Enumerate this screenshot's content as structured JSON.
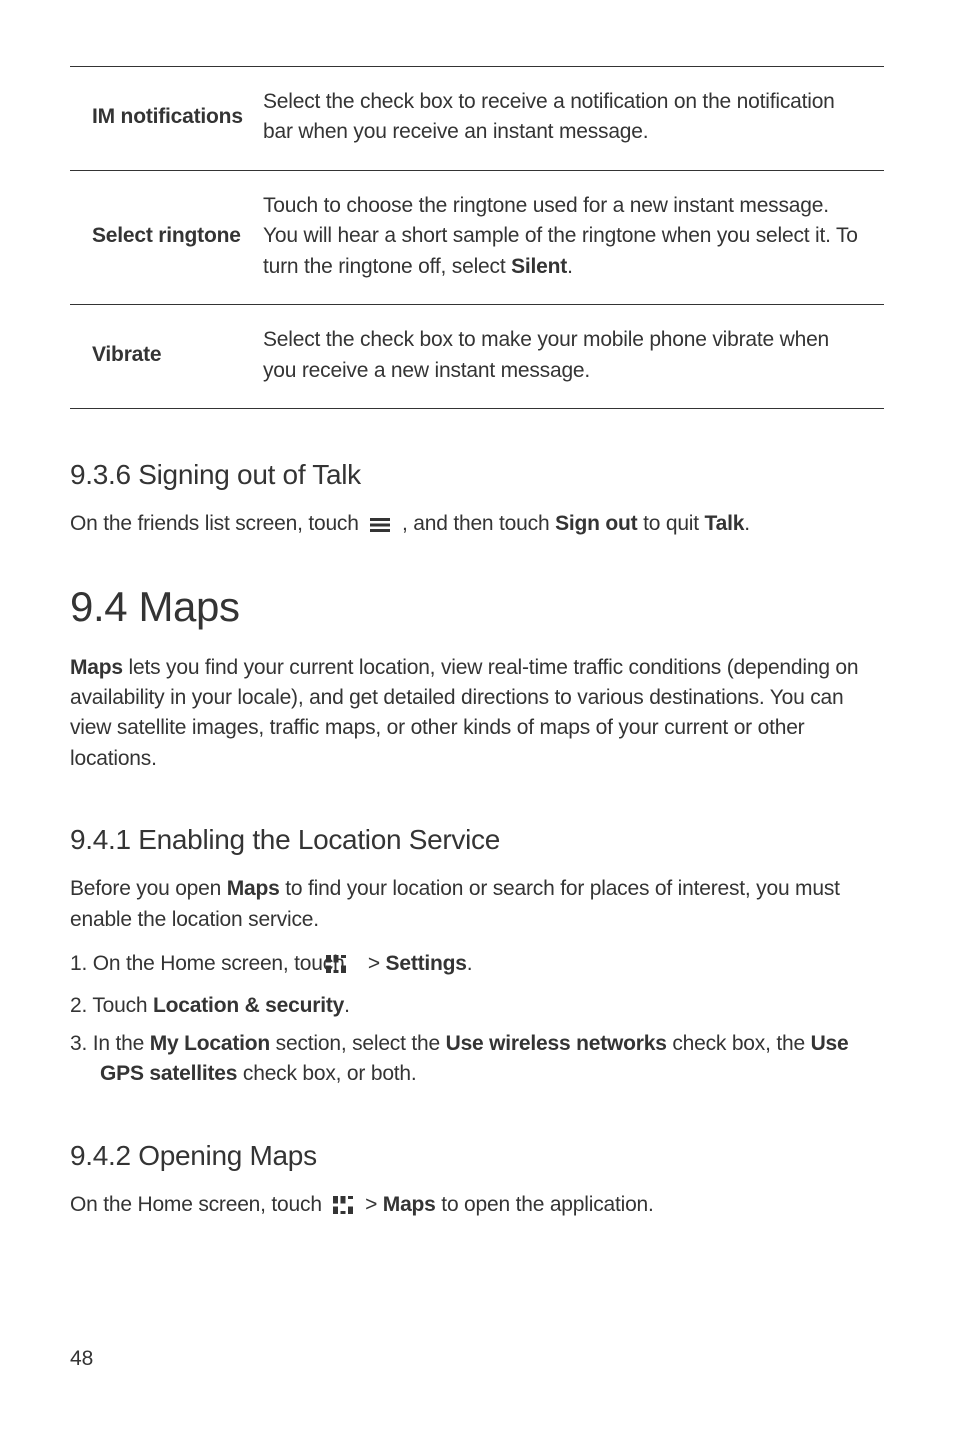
{
  "table": {
    "rows": [
      {
        "label": "IM notifications",
        "desc_plain": "Select the check box to receive a notification on the notification bar when you receive an instant message."
      },
      {
        "label": "Select ringtone",
        "desc_pre": "Touch to choose the ringtone used for a new instant message. You will hear a short sample of the ringtone when you select it. To turn the ringtone off, select ",
        "desc_bold": "Silent",
        "desc_post": "."
      },
      {
        "label": "Vibrate",
        "desc_plain": "Select the check box to make your mobile phone vibrate when you receive a new instant message."
      }
    ]
  },
  "sec936": {
    "heading": "9.3.6  Signing out of Talk",
    "p_pre": "On the friends list screen, touch ",
    "p_mid": " , and then touch ",
    "p_b1": "Sign out",
    "p_mid2": " to quit ",
    "p_b2": "Talk",
    "p_post": "."
  },
  "sec94": {
    "heading": "9.4  Maps",
    "intro_b": "Maps",
    "intro_rest": " lets you find your current location, view real-time traffic conditions (depending on availability in your locale), and get detailed directions to various destinations. You can view satellite images, traffic maps, or other kinds of maps of your current or other locations."
  },
  "sec941": {
    "heading": "9.4.1  Enabling the Location Service",
    "p_pre": "Before you open ",
    "p_b": "Maps",
    "p_post": " to find your location or search for places of interest, you must enable the location service.",
    "step1_pre": "1. On the Home screen, touch ",
    "step1_gt": "  > ",
    "step1_b": "Settings",
    "step1_post": ".",
    "step2_pre": "2. Touch ",
    "step2_b": "Location & security",
    "step2_post": ".",
    "step3_pre": "3. In the ",
    "step3_b1": "My Location",
    "step3_mid1": " section, select the ",
    "step3_b2": "Use wireless networks",
    "step3_mid2": " check box, the ",
    "step3_b3": "Use GPS satellites",
    "step3_post": " check box, or both."
  },
  "sec942": {
    "heading": "9.4.2  Opening Maps",
    "p_pre": "On the Home screen, touch ",
    "p_gt": "  > ",
    "p_b": "Maps",
    "p_post": " to open the application."
  },
  "page_number": "48"
}
